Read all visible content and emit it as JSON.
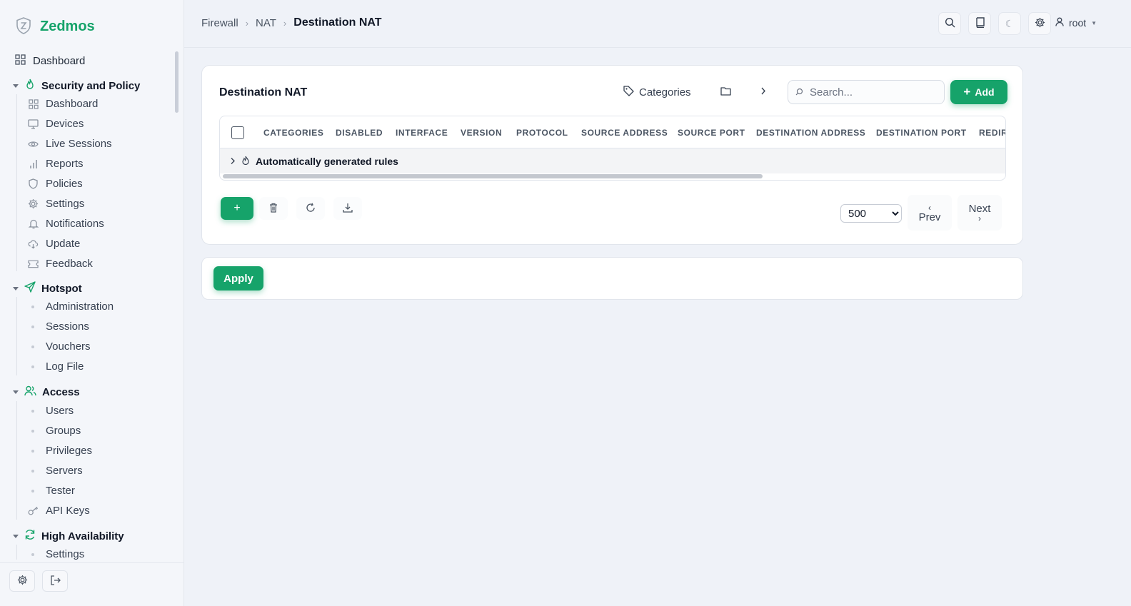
{
  "brand": {
    "name": "Zedmos"
  },
  "colors": {
    "accent": "#16a36a",
    "background": "#eff2f8"
  },
  "sidebar": {
    "top_item": {
      "label": "Dashboard",
      "icon": "grid-icon"
    },
    "sections": [
      {
        "label": "Security and Policy",
        "icon": "flame-icon",
        "items": [
          {
            "label": "Dashboard",
            "icon": "grid-icon"
          },
          {
            "label": "Devices",
            "icon": "monitor-icon"
          },
          {
            "label": "Live Sessions",
            "icon": "eye-icon"
          },
          {
            "label": "Reports",
            "icon": "bar-chart-icon"
          },
          {
            "label": "Policies",
            "icon": "shield-icon"
          },
          {
            "label": "Settings",
            "icon": "gear-icon"
          },
          {
            "label": "Notifications",
            "icon": "bell-icon"
          },
          {
            "label": "Update",
            "icon": "cloud-download-icon"
          },
          {
            "label": "Feedback",
            "icon": "ticket-icon"
          }
        ]
      },
      {
        "label": "Hotspot",
        "icon": "send-icon",
        "items": [
          {
            "label": "Administration"
          },
          {
            "label": "Sessions"
          },
          {
            "label": "Vouchers"
          },
          {
            "label": "Log File"
          }
        ]
      },
      {
        "label": "Access",
        "icon": "users-icon",
        "items": [
          {
            "label": "Users"
          },
          {
            "label": "Groups"
          },
          {
            "label": "Privileges"
          },
          {
            "label": "Servers"
          },
          {
            "label": "Tester"
          },
          {
            "label": "API Keys",
            "icon": "key-icon"
          }
        ]
      },
      {
        "label": "High Availability",
        "icon": "refresh-icon",
        "items": [
          {
            "label": "Settings"
          }
        ]
      }
    ]
  },
  "header": {
    "breadcrumb": [
      "Firewall",
      "NAT",
      "Destination NAT"
    ],
    "user": "root"
  },
  "main": {
    "title": "Destination NAT",
    "categories_label": "Categories",
    "search_placeholder": "Search...",
    "add_label": "Add",
    "columns": [
      "CATEGORIES",
      "DISABLED",
      "INTERFACE",
      "VERSION",
      "PROTOCOL",
      "SOURCE ADDRESS",
      "SOURCE PORT",
      "DESTINATION ADDRESS",
      "DESTINATION PORT",
      "REDIR"
    ],
    "group_row": "Automatically generated rules",
    "page_size": "500",
    "prev_label": "Prev",
    "next_label": "Next",
    "apply_label": "Apply"
  }
}
